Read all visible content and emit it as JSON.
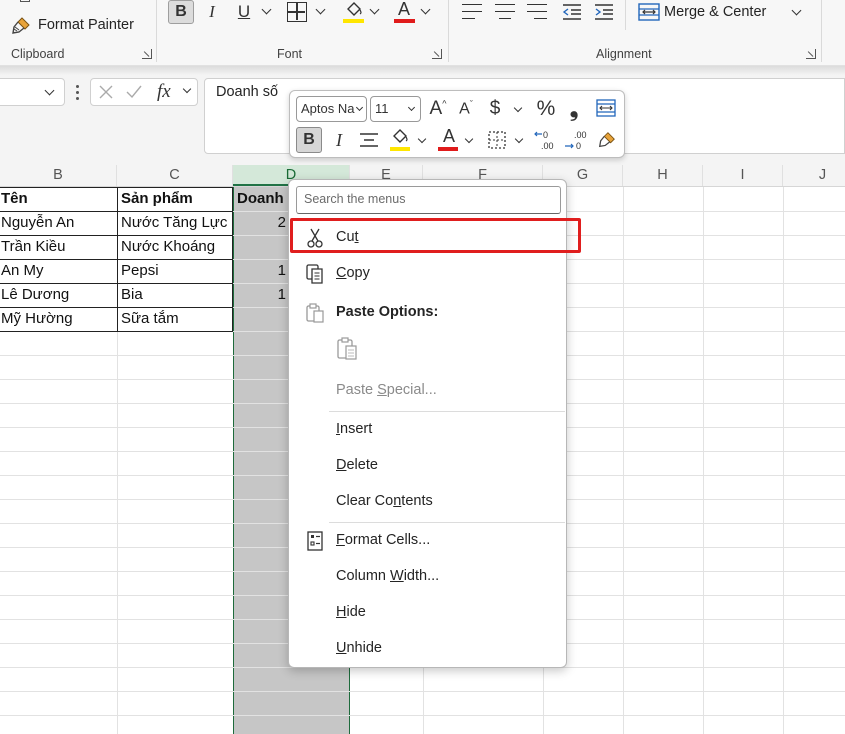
{
  "ribbon": {
    "clipboard": {
      "format_painter_label": "Format Painter",
      "group_label": "Clipboard"
    },
    "font": {
      "group_label": "Font",
      "highlight_color": "#ffe600",
      "font_color": "#e01b1b"
    },
    "alignment": {
      "merge_center_label": "Merge & Center",
      "group_label": "Alignment"
    }
  },
  "formula_bar": {
    "fx_label": "fx",
    "value": "Doanh số"
  },
  "mini_toolbar": {
    "font_name": "Aptos Na",
    "font_size": "11",
    "percent_glyph": "%",
    "comma_glyph": "❟",
    "dollar_glyph": "$"
  },
  "columns": [
    {
      "letter": "B"
    },
    {
      "letter": "C"
    },
    {
      "letter": "D"
    },
    {
      "letter": "E"
    },
    {
      "letter": "F"
    },
    {
      "letter": "G"
    },
    {
      "letter": "H"
    },
    {
      "letter": "I"
    },
    {
      "letter": "J"
    }
  ],
  "table": {
    "headers": [
      "Tên",
      "Sản phẩm",
      "Doanh"
    ],
    "rows": [
      {
        "name": "Nguyễn An",
        "product": "Nước Tăng Lực",
        "sales": "2"
      },
      {
        "name": "Trần Kiều",
        "product": "Nước Khoáng",
        "sales": ""
      },
      {
        "name": "An My",
        "product": "Pepsi",
        "sales": "1"
      },
      {
        "name": "Lê Dương",
        "product": "Bia",
        "sales": "1"
      },
      {
        "name": "Mỹ Hường",
        "product": "Sữa tắm",
        "sales": ""
      }
    ]
  },
  "context_menu": {
    "search_placeholder": "Search the menus",
    "paste_options_label": "Paste Options:",
    "items": {
      "cut": {
        "pre": "Cu",
        "key": "t",
        "post": ""
      },
      "copy": {
        "pre": "",
        "key": "C",
        "post": "opy"
      },
      "paste_special": {
        "pre": "Paste ",
        "key": "S",
        "post": "pecial..."
      },
      "insert": {
        "pre": "",
        "key": "I",
        "post": "nsert"
      },
      "delete": {
        "pre": "",
        "key": "D",
        "post": "elete"
      },
      "clear_contents": {
        "pre": "Clear Co",
        "key": "n",
        "post": "tents"
      },
      "format_cells": {
        "pre": "",
        "key": "F",
        "post": "ormat Cells..."
      },
      "column_width": {
        "pre": "Column ",
        "key": "W",
        "post": "idth..."
      },
      "hide": {
        "pre": "",
        "key": "H",
        "post": "ide"
      },
      "unhide": {
        "pre": "",
        "key": "U",
        "post": "nhide"
      }
    }
  },
  "colors": {
    "selection_green": "#1e6b3c",
    "selected_column_fill": "#c6c6c6",
    "annotation_red": "#e01e1e"
  }
}
